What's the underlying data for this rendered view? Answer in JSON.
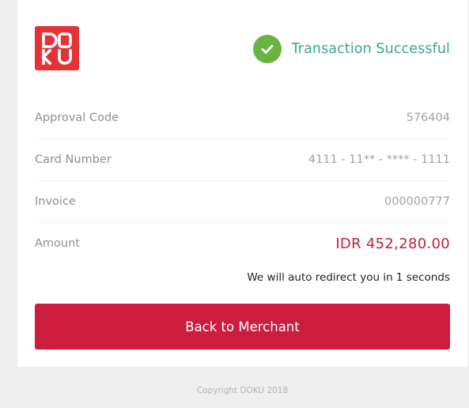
{
  "brand": {
    "logo_text": "DOKU",
    "logo_icon": "doku-logo",
    "color": "#e53238"
  },
  "status": {
    "icon": "check-circle-icon",
    "text": "Transaction Successful",
    "icon_color": "#69b341",
    "text_color": "#3aa68f"
  },
  "details": {
    "approval_code": {
      "label": "Approval Code",
      "value": "576404"
    },
    "card_number": {
      "label": "Card Number",
      "value": "4111 - 11** - **** - 1111"
    },
    "invoice": {
      "label": "Invoice",
      "value": "000000777"
    },
    "amount": {
      "label": "Amount",
      "value": "IDR 452,280.00",
      "color": "#c41e3a"
    }
  },
  "redirect_text": "We will auto redirect you in 1 seconds",
  "back_button": {
    "label": "Back to Merchant",
    "color": "#cc1d3d"
  },
  "footer": {
    "copyright": "Copyright DOKU 2018"
  }
}
